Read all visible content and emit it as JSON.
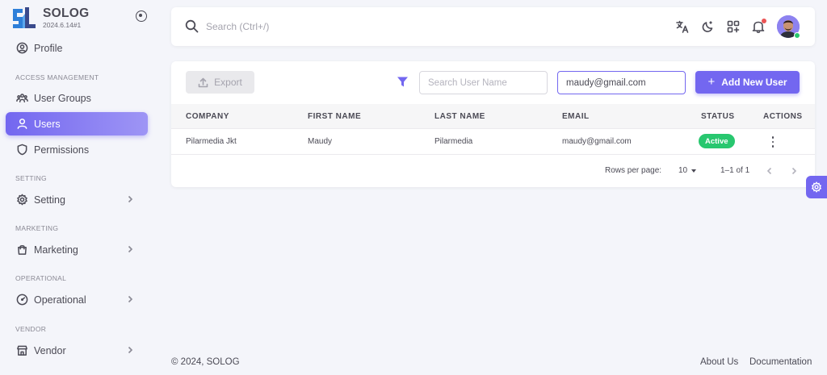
{
  "brand": {
    "name": "SOLOG",
    "version": "2024.6.14#1",
    "accent": "#7367f0"
  },
  "sidebar": {
    "profile": "Profile",
    "sections": {
      "access": "ACCESS MANAGEMENT",
      "setting": "SETTING",
      "marketing": "MARKETING",
      "operational": "OPERATIONAL",
      "vendor": "VENDOR"
    },
    "items": {
      "user_groups": "User Groups",
      "users": "Users",
      "permissions": "Permissions",
      "setting": "Setting",
      "marketing": "Marketing",
      "operational": "Operational",
      "vendor": "Vendor"
    }
  },
  "topbar": {
    "search_placeholder": "Search (Ctrl+/)",
    "icons": [
      "translate-icon",
      "moon-icon",
      "apps-add-icon",
      "bell-icon"
    ]
  },
  "toolbar": {
    "export_label": "Export",
    "search_user_placeholder": "Search User Name",
    "email_value": "maudy@gmail.com",
    "add_label": "Add New User"
  },
  "table": {
    "headers": [
      "COMPANY",
      "FIRST NAME",
      "LAST NAME",
      "EMAIL",
      "STATUS",
      "ACTIONS"
    ],
    "rows": [
      {
        "company": "Pilarmedia Jkt",
        "first_name": "Maudy",
        "last_name": "Pilarmedia",
        "email": "maudy@gmail.com",
        "status": "Active"
      }
    ]
  },
  "pagination": {
    "rows_label": "Rows per page:",
    "rows_value": "10",
    "range": "1–1 of 1"
  },
  "footer": {
    "copyright": "© 2024, SOLOG",
    "about": "About Us",
    "docs": "Documentation"
  },
  "colors": {
    "accent": "#7367f0",
    "success": "#28c76f",
    "danger": "#ea5455"
  }
}
